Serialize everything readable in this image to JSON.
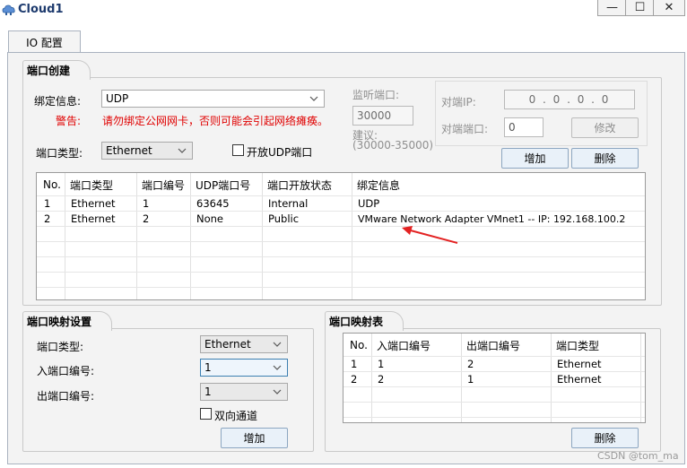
{
  "window": {
    "title": "Cloud1",
    "min_glyph": "—",
    "max_glyph": "☐",
    "close_glyph": "✕"
  },
  "tabs": [
    {
      "label": "IO 配置"
    }
  ],
  "port_create": {
    "title": "端口创建",
    "binding_label": "绑定信息:",
    "binding_value": "UDP",
    "warning_label": "警告:",
    "warning_text": "请勿绑定公网网卡，否则可能会引起网络瘫痪。",
    "port_type_label": "端口类型:",
    "port_type_value": "Ethernet",
    "open_udp_label": "开放UDP端口",
    "listen_port_label": "监听端口:",
    "listen_port_value": "30000",
    "suggest_label": "建议:",
    "suggest_range": "(30000-35000)",
    "peer_ip_label": "对端IP:",
    "peer_ip_value": "0 . 0 . 0 . 0",
    "peer_port_label": "对端端口:",
    "peer_port_value": "0",
    "modify_button": "修改",
    "add_button": "增加",
    "delete_button": "删除",
    "table": {
      "headers": [
        "No.",
        "端口类型",
        "端口编号",
        "UDP端口号",
        "端口开放状态",
        "绑定信息"
      ],
      "rows": [
        [
          "1",
          "Ethernet",
          "1",
          "63645",
          "Internal",
          "UDP"
        ],
        [
          "2",
          "Ethernet",
          "2",
          "None",
          "Public",
          "VMware Network Adapter VMnet1 -- IP: 192.168.100.2"
        ]
      ]
    }
  },
  "port_map_settings": {
    "title": "端口映射设置",
    "port_type_label": "端口类型:",
    "port_type_value": "Ethernet",
    "in_port_label": "入端口编号:",
    "in_port_value": "1",
    "out_port_label": "出端口编号:",
    "out_port_value": "1",
    "bidirectional_label": "双向通道",
    "add_button": "增加"
  },
  "port_map_table": {
    "title": "端口映射表",
    "headers": [
      "No.",
      "入端口编号",
      "出端口编号",
      "端口类型"
    ],
    "rows": [
      [
        "1",
        "1",
        "2",
        "Ethernet"
      ],
      [
        "2",
        "2",
        "1",
        "Ethernet"
      ]
    ],
    "delete_button": "删除"
  },
  "watermark": "CSDN @tom_ma",
  "colors": {
    "warning_red": "#e00000",
    "arrow_red": "#e32222",
    "panel_bg": "#f3f3f3"
  }
}
